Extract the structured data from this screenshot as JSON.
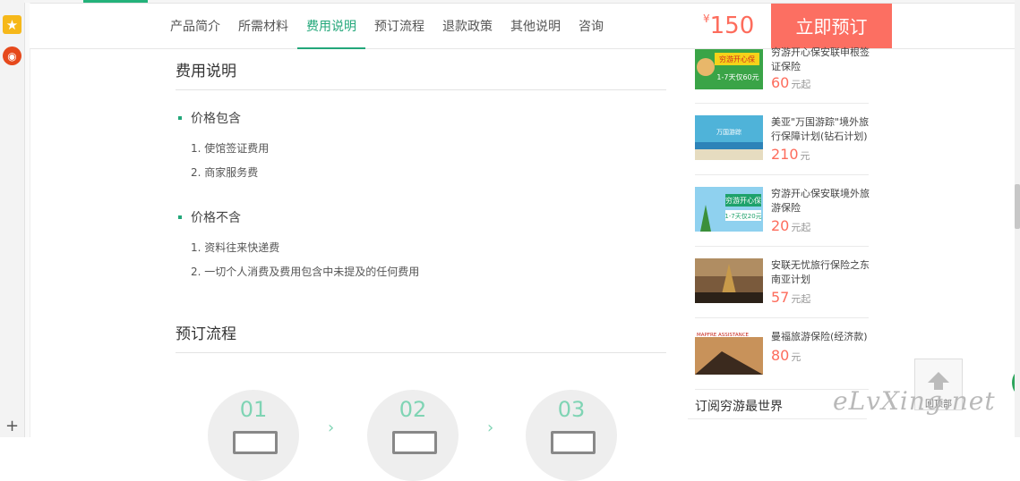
{
  "nav": {
    "tabs": [
      "产品简介",
      "所需材料",
      "费用说明",
      "预订流程",
      "退款政策",
      "其他说明",
      "咨询"
    ],
    "active_tab": "费用说明",
    "price_currency": "¥",
    "price": "150",
    "book_label": "立即预订"
  },
  "fees": {
    "title": "费用说明",
    "included_label": "价格包含",
    "included": [
      "1. 使馆签证费用",
      "2. 商家服务费"
    ],
    "excluded_label": "价格不含",
    "excluded": [
      "1. 资料往来快递费",
      "2. 一切个人消费及费用包含中未提及的任何费用"
    ]
  },
  "process": {
    "title": "预订流程",
    "steps": [
      "01",
      "02",
      "03"
    ]
  },
  "sidebar": {
    "products": [
      {
        "title": "穷游开心保安联申根签证保险",
        "price": "60",
        "unit": "元起"
      },
      {
        "title": "美亚\"万国游踪\"境外旅行保障计划(钻石计划)",
        "price": "210",
        "unit": "元",
        "thumb_text": "万国游踪"
      },
      {
        "title": "穷游开心保安联境外旅游保险",
        "price": "20",
        "unit": "元起"
      },
      {
        "title": "安联无忧旅行保险之东南亚计划",
        "price": "57",
        "unit": "元起"
      },
      {
        "title": "曼福旅游保险(经济款)",
        "price": "80",
        "unit": "元",
        "thumb_text": "MAPFRE ASSISTANCE"
      }
    ],
    "subscribe_label": "订阅穷游最世界"
  },
  "back_to_top": "回顶部",
  "watermark": "eLvXing.net",
  "colors": {
    "accent": "#23a77a",
    "price": "#fd6c5c",
    "book_bg": "#fc6f62"
  }
}
